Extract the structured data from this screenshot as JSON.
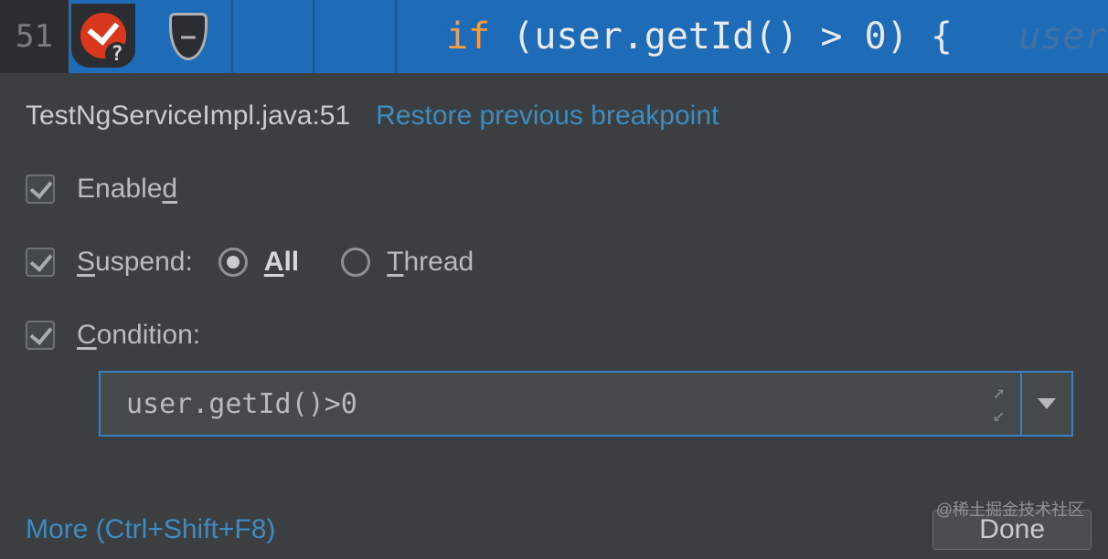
{
  "code": {
    "line_number": "51",
    "kw": "if",
    "expr": "(user.getId() > 0) {",
    "hint": "user"
  },
  "breakpoint": {
    "title": "TestNgServiceImpl.java:51",
    "restore": "Restore previous breakpoint",
    "enabled_label": "Enable",
    "enabled_mnemonic": "d",
    "suspend_label_pre": "",
    "suspend_label_mnemonic": "S",
    "suspend_label_post": "uspend:",
    "all_mnemonic": "A",
    "all_post": "ll",
    "thread_mnemonic": "T",
    "thread_post": "hread",
    "condition_mnemonic": "C",
    "condition_post": "ondition:",
    "condition_value": "user.getId()>0"
  },
  "footer": {
    "more": "More (Ctrl+Shift+F8)",
    "done": "Done"
  },
  "watermark": "@稀土掘金技术社区"
}
